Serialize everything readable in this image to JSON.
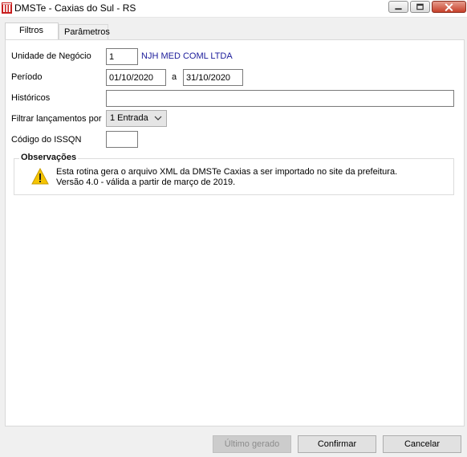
{
  "window": {
    "title": "DMSTe - Caxias do Sul - RS"
  },
  "tabs": [
    {
      "label": "Filtros",
      "active": true
    },
    {
      "label": "Parâmetros",
      "active": false
    }
  ],
  "form": {
    "unidade_label": "Unidade de Negócio",
    "unidade_value": "1",
    "unidade_name": "NJH MED COML LTDA",
    "periodo_label": "Período",
    "periodo_start": "01/10/2020",
    "periodo_sep": "a",
    "periodo_end": "31/10/2020",
    "historicos_label": "Históricos",
    "historicos_value": "",
    "filtrar_label": "Filtrar lançamentos por",
    "filtrar_value": "1 Entrada",
    "issqn_label": "Código do ISSQN",
    "issqn_value": ""
  },
  "observacoes": {
    "title": "Observações",
    "line1": "Esta rotina gera o arquivo XML da DMSTe Caxias a ser importado no site da prefeitura.",
    "line2": "Versão 4.0 - válida a partir de março de 2019.",
    "icon": "warning-icon"
  },
  "buttons": {
    "ultimo": "Último gerado",
    "confirmar": "Confirmar",
    "cancelar": "Cancelar"
  },
  "colors": {
    "accent_text": "#1b1b9a",
    "warning": "#f5c400"
  }
}
